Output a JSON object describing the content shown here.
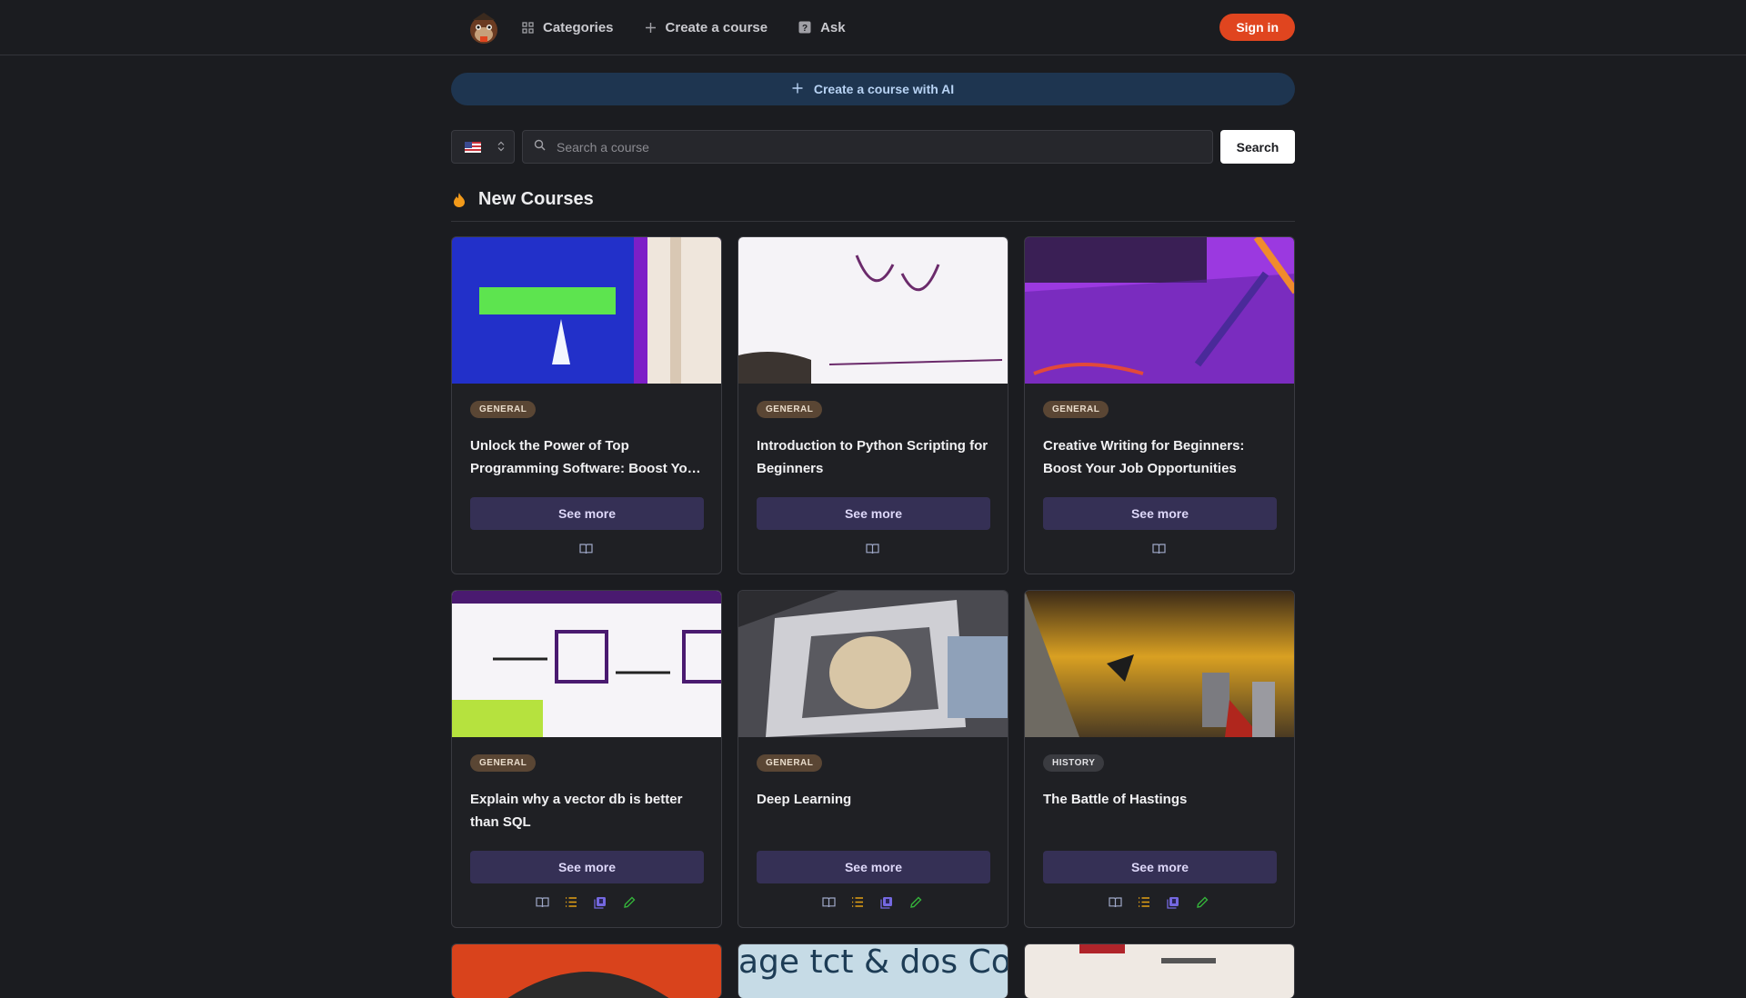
{
  "nav": {
    "logo_alt": "logo",
    "items": [
      {
        "label": "Categories",
        "icon": "grid-icon"
      },
      {
        "label": "Create a course",
        "icon": "plus-icon"
      },
      {
        "label": "Ask",
        "icon": "question-icon"
      }
    ],
    "signin_label": "Sign in"
  },
  "ai_banner": {
    "label": "Create a course with AI",
    "icon": "plus-icon"
  },
  "search": {
    "language_flag": "us-flag",
    "placeholder": "Search a course",
    "value": "",
    "button_label": "Search"
  },
  "section": {
    "title": "New Courses",
    "icon": "fire-icon"
  },
  "courses": [
    {
      "category": "GENERAL",
      "title": "Unlock the Power of Top Programming Software: Boost Yo…",
      "see_more": "See more",
      "actions": [
        "book-icon"
      ],
      "thumb_palette": [
        "#2230c9",
        "#7d1fc7",
        "#5de44f"
      ]
    },
    {
      "category": "GENERAL",
      "title": "Introduction to Python Scripting for Beginners",
      "see_more": "See more",
      "actions": [
        "book-icon"
      ],
      "thumb_palette": [
        "#f5f3f7",
        "#6b2a6b",
        "#3b3430"
      ]
    },
    {
      "category": "GENERAL",
      "title": "Creative Writing for Beginners: Boost Your Job Opportunities",
      "see_more": "See more",
      "actions": [
        "book-icon"
      ],
      "thumb_palette": [
        "#9b39e0",
        "#5e22a4",
        "#e2493a"
      ]
    },
    {
      "category": "GENERAL",
      "title": "Explain why a vector db is better than SQL",
      "see_more": "See more",
      "actions": [
        "book-icon",
        "list-icon",
        "library-icon",
        "pencil-icon"
      ],
      "thumb_palette": [
        "#f6f4f8",
        "#4a1a70",
        "#b6e23e"
      ]
    },
    {
      "category": "GENERAL",
      "title": "Deep Learning",
      "see_more": "See more",
      "actions": [
        "book-icon",
        "list-icon",
        "library-icon",
        "pencil-icon"
      ],
      "thumb_palette": [
        "#2c2c30",
        "#d8c6a6",
        "#8fa1b9"
      ]
    },
    {
      "category": "HISTORY",
      "title": "The Battle of Hastings",
      "see_more": "See more",
      "actions": [
        "book-icon",
        "list-icon",
        "library-icon",
        "pencil-icon"
      ],
      "thumb_palette": [
        "#d9a022",
        "#3b2a17",
        "#b0261d"
      ]
    }
  ],
  "partial_row": [
    {
      "thumb_palette": [
        "#d9431c",
        "#2b2b2b"
      ]
    },
    {
      "thumb_text": "age tct & dos Cos",
      "thumb_palette": [
        "#c6dbe6",
        "#1d3c55"
      ]
    },
    {
      "thumb_palette": [
        "#efe9e3",
        "#b0242a"
      ]
    }
  ],
  "colors": {
    "accent": "#e0451f",
    "banner": "#1e3550",
    "button": "#353055",
    "action_book": "#9fa8c8",
    "action_list": "#e3a014",
    "action_library": "#7468e0",
    "action_pencil": "#34b23a"
  }
}
